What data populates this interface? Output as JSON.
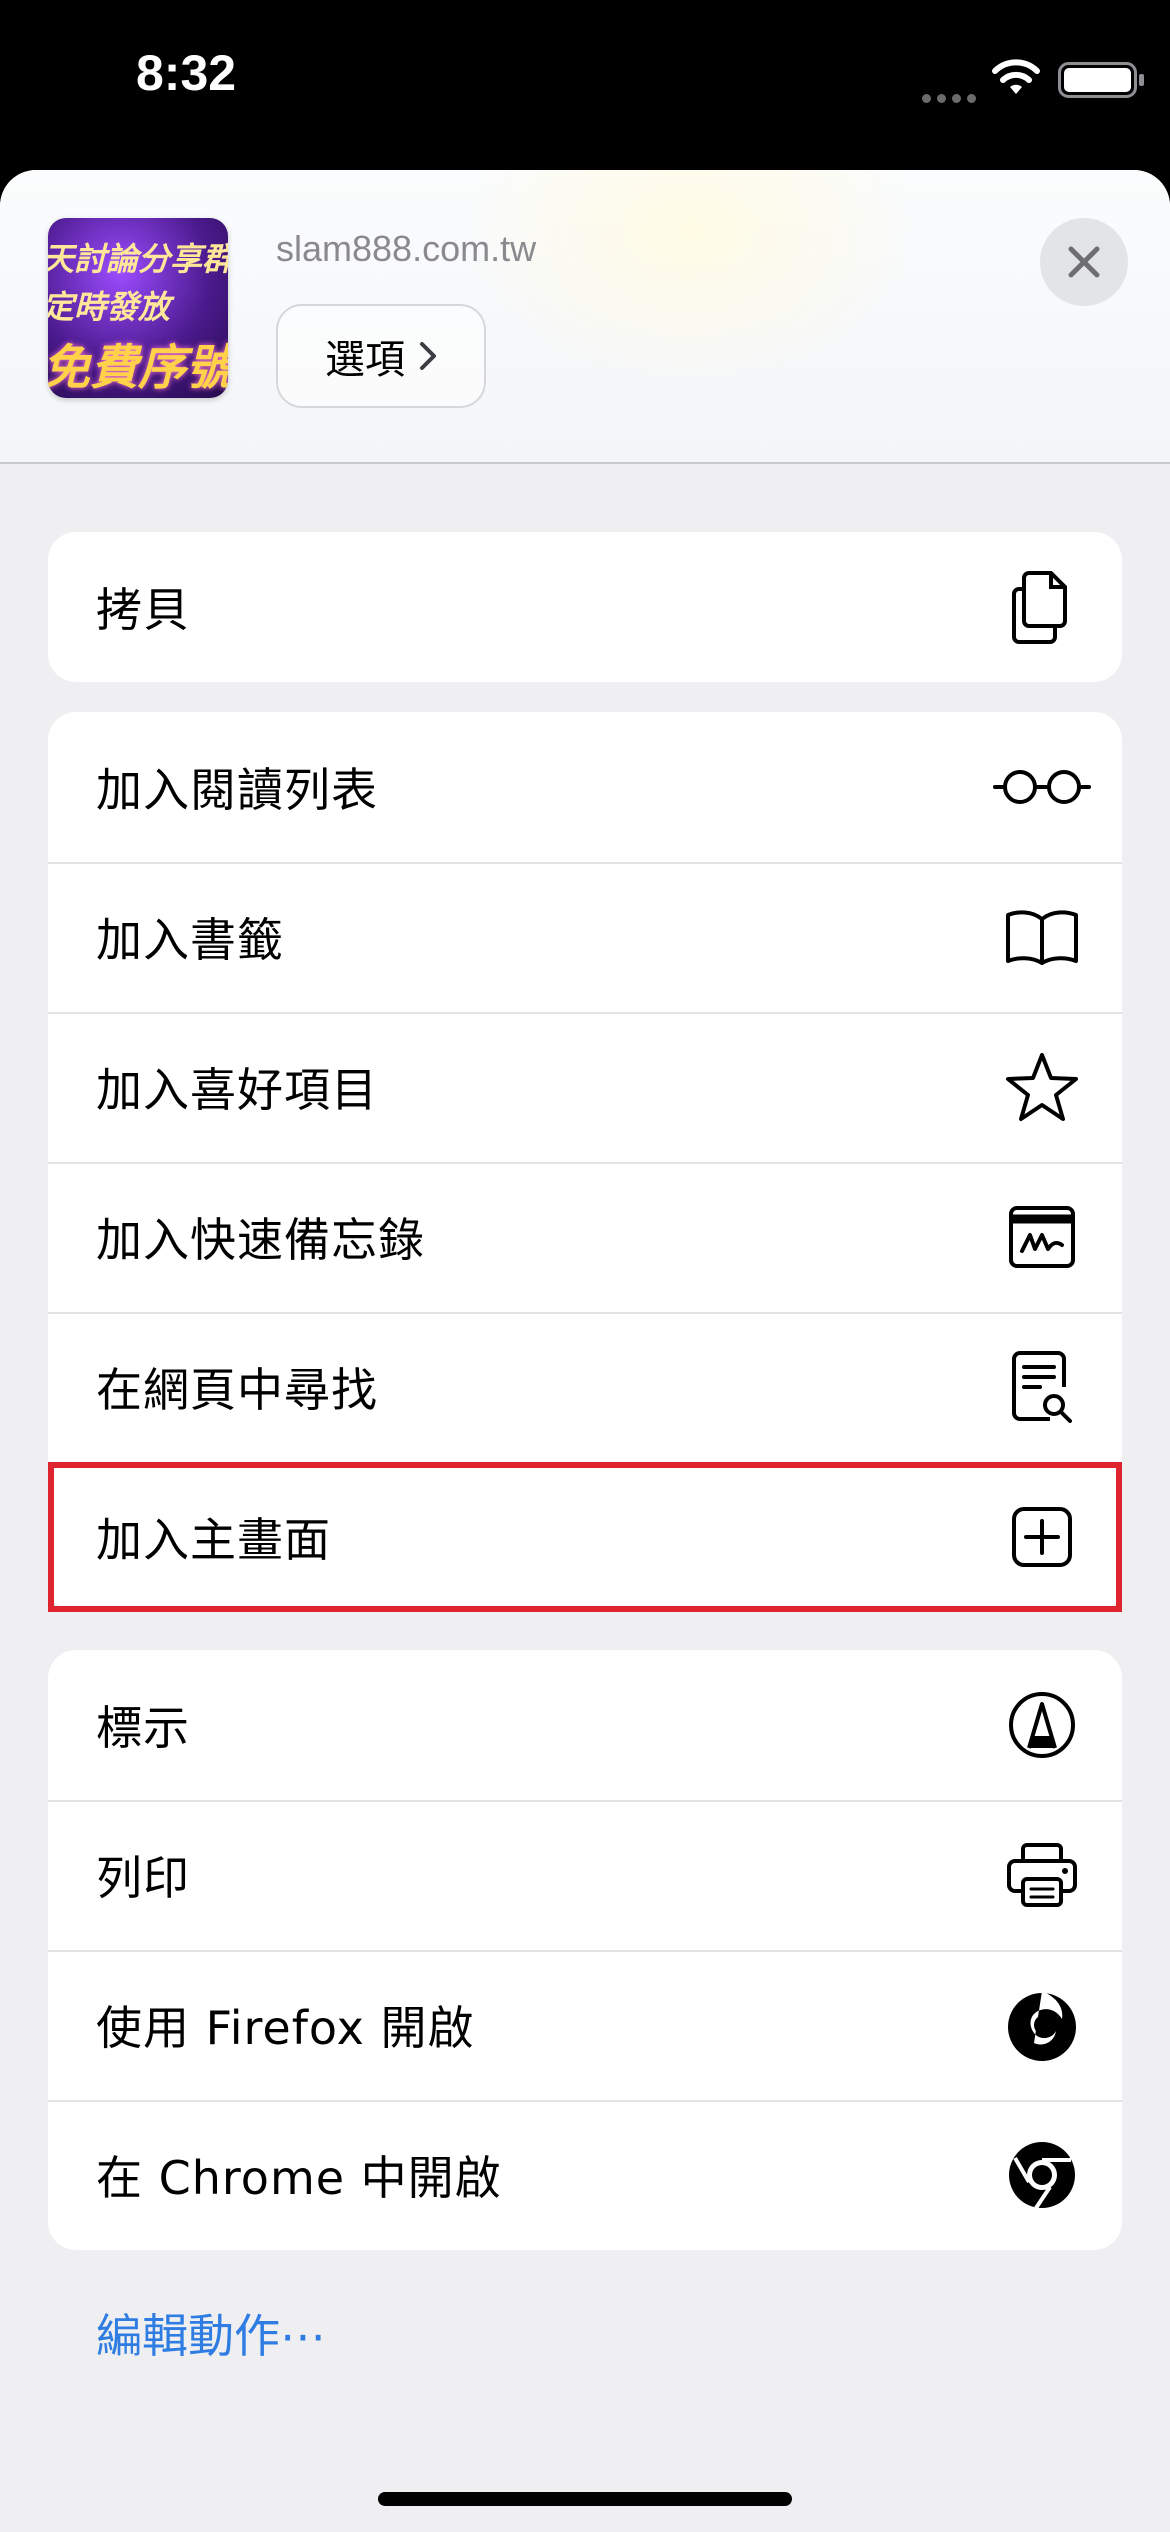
{
  "status_bar": {
    "time": "8:32"
  },
  "share_header": {
    "thumbnail_text": [
      "天討論分享群",
      "定時發放",
      "免費序號"
    ],
    "domain": "slam888.com.tw",
    "options_label": "選項"
  },
  "groups": [
    {
      "items": [
        {
          "label": "拷貝",
          "icon": "copy-icon"
        }
      ]
    },
    {
      "items": [
        {
          "label": "加入閱讀列表",
          "icon": "glasses-icon"
        },
        {
          "label": "加入書籤",
          "icon": "book-icon"
        },
        {
          "label": "加入喜好項目",
          "icon": "star-icon"
        },
        {
          "label": "加入快速備忘錄",
          "icon": "quick-note-icon"
        },
        {
          "label": "在網頁中尋找",
          "icon": "find-in-page-icon"
        },
        {
          "label": "加入主畫面",
          "icon": "add-square-icon",
          "highlighted": true
        }
      ]
    },
    {
      "items": [
        {
          "label": "標示",
          "icon": "markup-pen-icon"
        },
        {
          "label": "列印",
          "icon": "printer-icon"
        },
        {
          "label": "使用 Firefox 開啟",
          "icon": "firefox-icon"
        },
        {
          "label": "在 Chrome 中開啟",
          "icon": "chrome-icon"
        }
      ]
    }
  ],
  "edit_actions_label": "編輯動作⋯",
  "colors": {
    "highlight": "#e0242f",
    "link": "#2f7de3",
    "sheet_background": "#efeff1"
  }
}
